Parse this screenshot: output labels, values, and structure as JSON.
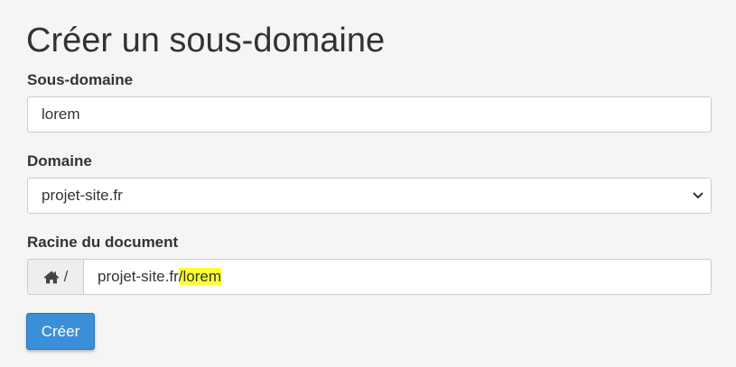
{
  "page": {
    "title": "Créer un sous-domaine"
  },
  "form": {
    "subdomain": {
      "label": "Sous-domaine",
      "value": "lorem"
    },
    "domain": {
      "label": "Domaine",
      "selected": "projet-site.fr"
    },
    "document_root": {
      "label": "Racine du document",
      "addon_icon": "home-icon",
      "addon_text": "/",
      "path_prefix": "projet-site.fr",
      "path_suffix": "/lorem"
    },
    "submit_label": "Créer"
  },
  "colors": {
    "background": "#f5f5f5",
    "primary_button": "#3a8fd8",
    "highlight": "#ffff33",
    "addon_background": "#eeeeee"
  }
}
